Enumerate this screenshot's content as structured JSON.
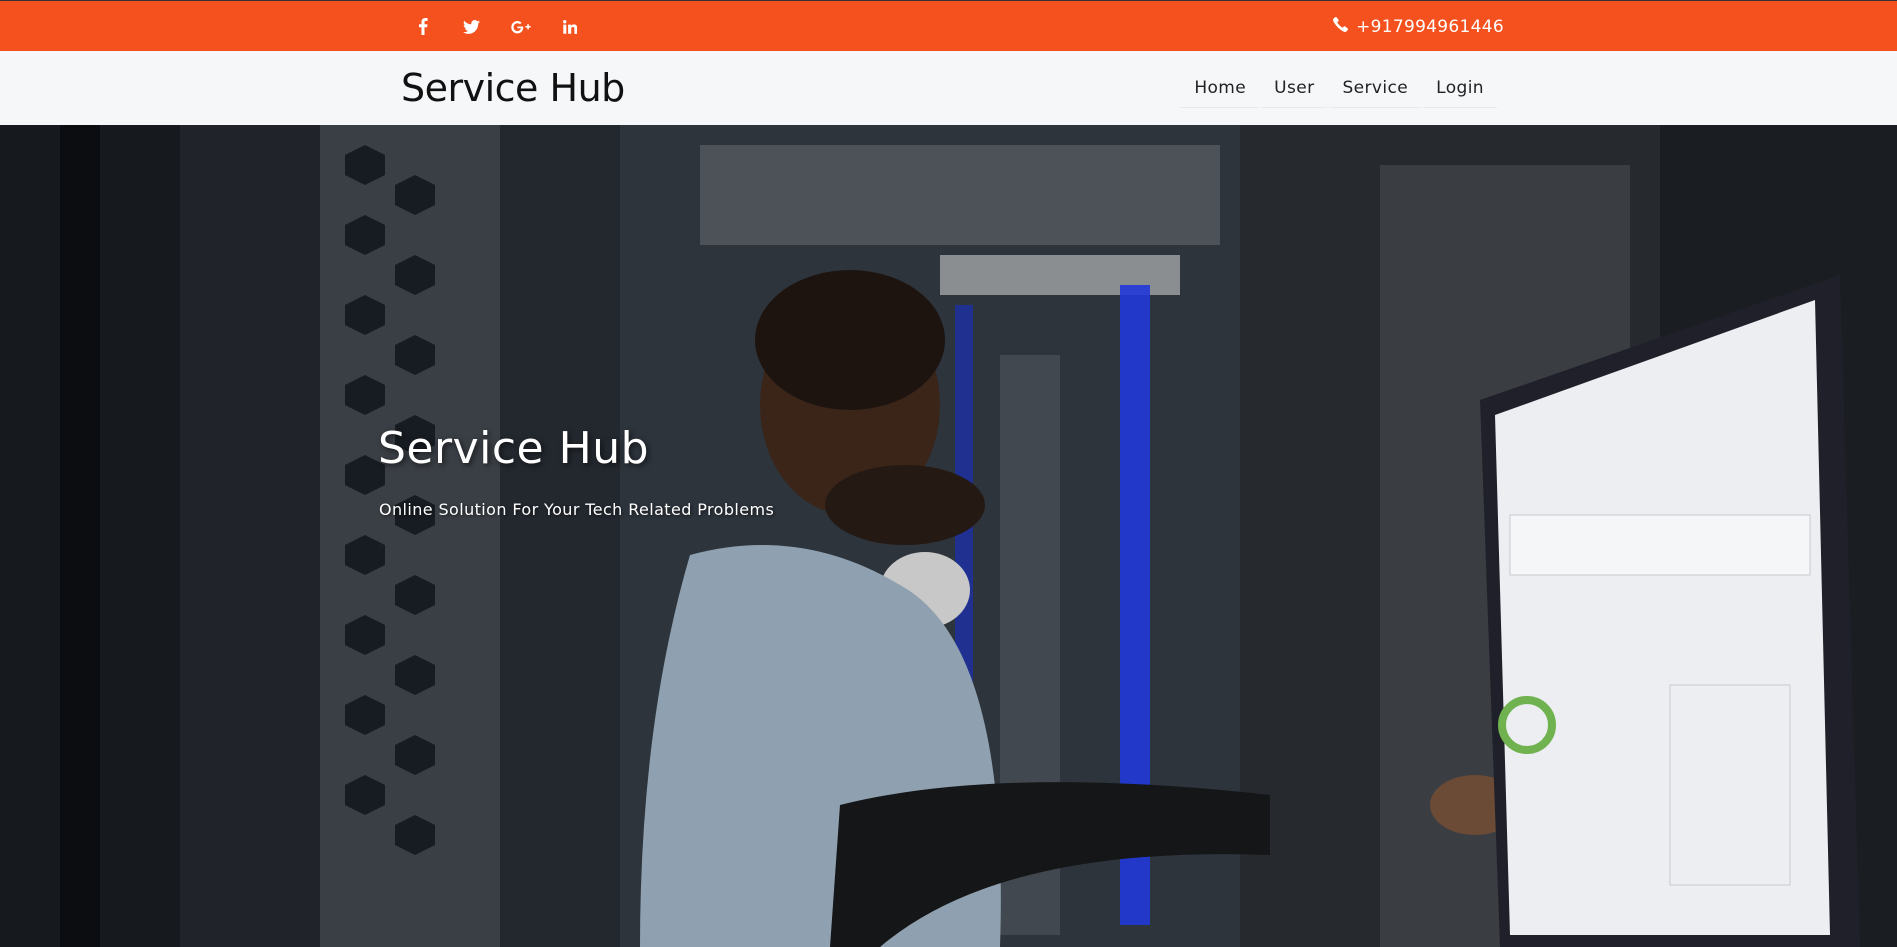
{
  "topbar": {
    "social": [
      {
        "icon": "facebook-icon"
      },
      {
        "icon": "twitter-icon"
      },
      {
        "icon": "google-plus-icon"
      },
      {
        "icon": "linkedin-icon"
      }
    ],
    "phone": "+917994961446",
    "accent_color": "#f4511e"
  },
  "navbar": {
    "brand": "Service Hub",
    "items": [
      {
        "label": "Home"
      },
      {
        "label": "User"
      },
      {
        "label": "Service"
      },
      {
        "label": "Login"
      }
    ]
  },
  "hero": {
    "title": "Service Hub",
    "subtitle": "Online Solution For Your Tech Related Problems",
    "arrow": "›"
  }
}
